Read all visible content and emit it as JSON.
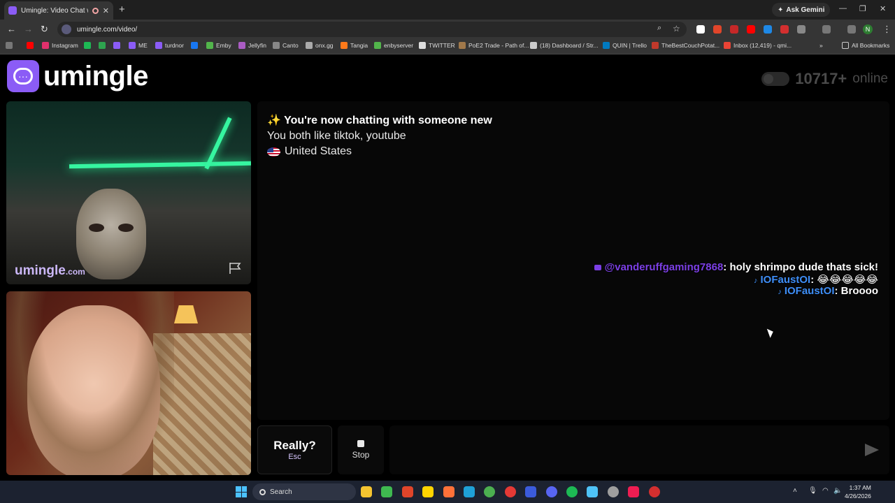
{
  "browser": {
    "tab_title": "Umingle: Video Chat with S",
    "tab_close": "✕",
    "new_tab": "+",
    "ask_gemini": "Ask Gemini",
    "url": "umingle.com/video/",
    "profile_initial": "N",
    "bookmarks": [
      {
        "label": "",
        "color": "#ff0000"
      },
      {
        "label": "Instagram",
        "color": "#e1306c"
      },
      {
        "label": "",
        "color": "#1db954"
      },
      {
        "label": "",
        "color": "#2ea44f"
      },
      {
        "label": "",
        "color": "#8b5cf6"
      },
      {
        "label": "ME",
        "color": "#8b5cf6"
      },
      {
        "label": "turdnor",
        "color": "#8b5cf6"
      },
      {
        "label": "",
        "color": "#1877f2"
      },
      {
        "label": "Emby",
        "color": "#52b54b"
      },
      {
        "label": "Jellyfin",
        "color": "#aa5cc3"
      },
      {
        "label": "Canto",
        "color": "#888888"
      },
      {
        "label": "onx.gg",
        "color": "#aaaaaa"
      },
      {
        "label": "Tangia",
        "color": "#ff7a1a"
      },
      {
        "label": "enbyserver",
        "color": "#52b54b"
      },
      {
        "label": "TWITTER",
        "color": "#dddddd"
      },
      {
        "label": "PoE2 Trade - Path of...",
        "color": "#a0784a"
      },
      {
        "label": "(18) Dashboard / Str...",
        "color": "#cccccc"
      },
      {
        "label": "QUIN | Trello",
        "color": "#0079bf"
      },
      {
        "label": "TheBestCouchPotat...",
        "color": "#c0392b"
      },
      {
        "label": "Inbox (12,419) - qmi...",
        "color": "#ea4335"
      }
    ],
    "all_bookmarks": "All Bookmarks"
  },
  "header": {
    "logo_text": "umingle",
    "online_count": "10717+",
    "online_label": "online"
  },
  "remote_video": {
    "watermark": "umingle",
    "watermark_suffix": ".com"
  },
  "chat": {
    "system_title": "✨ You're now chatting with someone new",
    "interests": "You both like tiktok, youtube",
    "country": "United States",
    "overlay_messages": [
      {
        "platform": "youtube",
        "user": "@vanderuffgaming7868",
        "text": ": holy shrimpo dude thats sick!"
      },
      {
        "platform": "tiktok",
        "user": "IOFaustOI",
        "text": ": 😂😂😂😂😂"
      },
      {
        "platform": "tiktok",
        "user": "IOFaustOI",
        "text": ": Broooo"
      }
    ]
  },
  "controls": {
    "really_label": "Really?",
    "really_hint": "Esc",
    "stop_label": "Stop",
    "input_value": ""
  },
  "taskbar": {
    "search_label": "Search",
    "time": "1:37 AM",
    "date": "4/26/2026"
  },
  "colors": {
    "brand": "#8b5cf6",
    "youtube_user": "#7b3fe4",
    "tiktok_user": "#3e8ef7"
  }
}
